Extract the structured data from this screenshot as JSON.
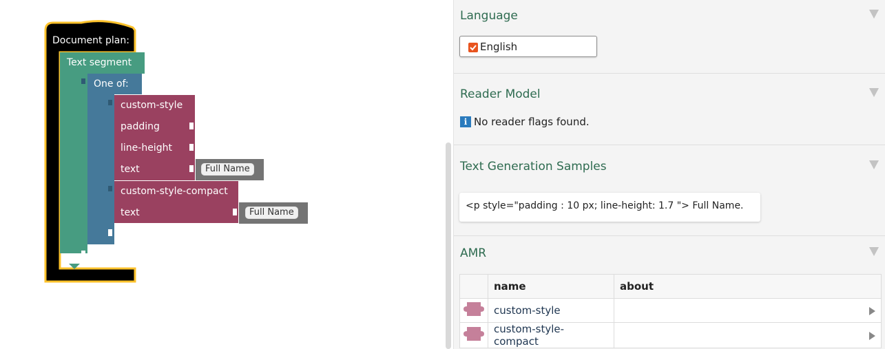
{
  "workspace": {
    "document_plan_label": "Document plan:",
    "text_segment_label": "Text segment",
    "one_of_label": "One of:",
    "custom_style": {
      "title": "custom-style",
      "inputs": [
        "padding",
        "line-height",
        "text"
      ],
      "text_field": "Full Name"
    },
    "custom_style_compact": {
      "title": "custom-style-compact",
      "inputs": [
        "text"
      ],
      "text_field": "Full Name"
    }
  },
  "panel": {
    "language": {
      "title": "Language",
      "option_label": "English",
      "checked": true
    },
    "reader_model": {
      "title": "Reader Model",
      "message": "No reader flags found.",
      "info_icon": "i"
    },
    "samples": {
      "title": "Text Generation Samples",
      "sample_text": "<p style=\"padding : 10 px; line-height: 1.7 \"> Full Name."
    },
    "amr": {
      "title": "AMR",
      "columns": [
        "",
        "name",
        "about"
      ],
      "rows": [
        {
          "name": "custom-style",
          "about": ""
        },
        {
          "name": "custom-style-compact",
          "about": ""
        }
      ]
    }
  },
  "colors": {
    "document_plan": "#000000",
    "document_plan_outline": "#fdc22b",
    "text_segment": "#479c81",
    "one_of": "#45799a",
    "amr_block": "#9a4160",
    "field_block": "#747474",
    "accent_title": "#2e6b50"
  },
  "icons": [
    "dropdown-chevron-icon",
    "checkbox-checked-icon",
    "info-icon",
    "puzzle-piece-icon",
    "expand-arrow-icon"
  ]
}
